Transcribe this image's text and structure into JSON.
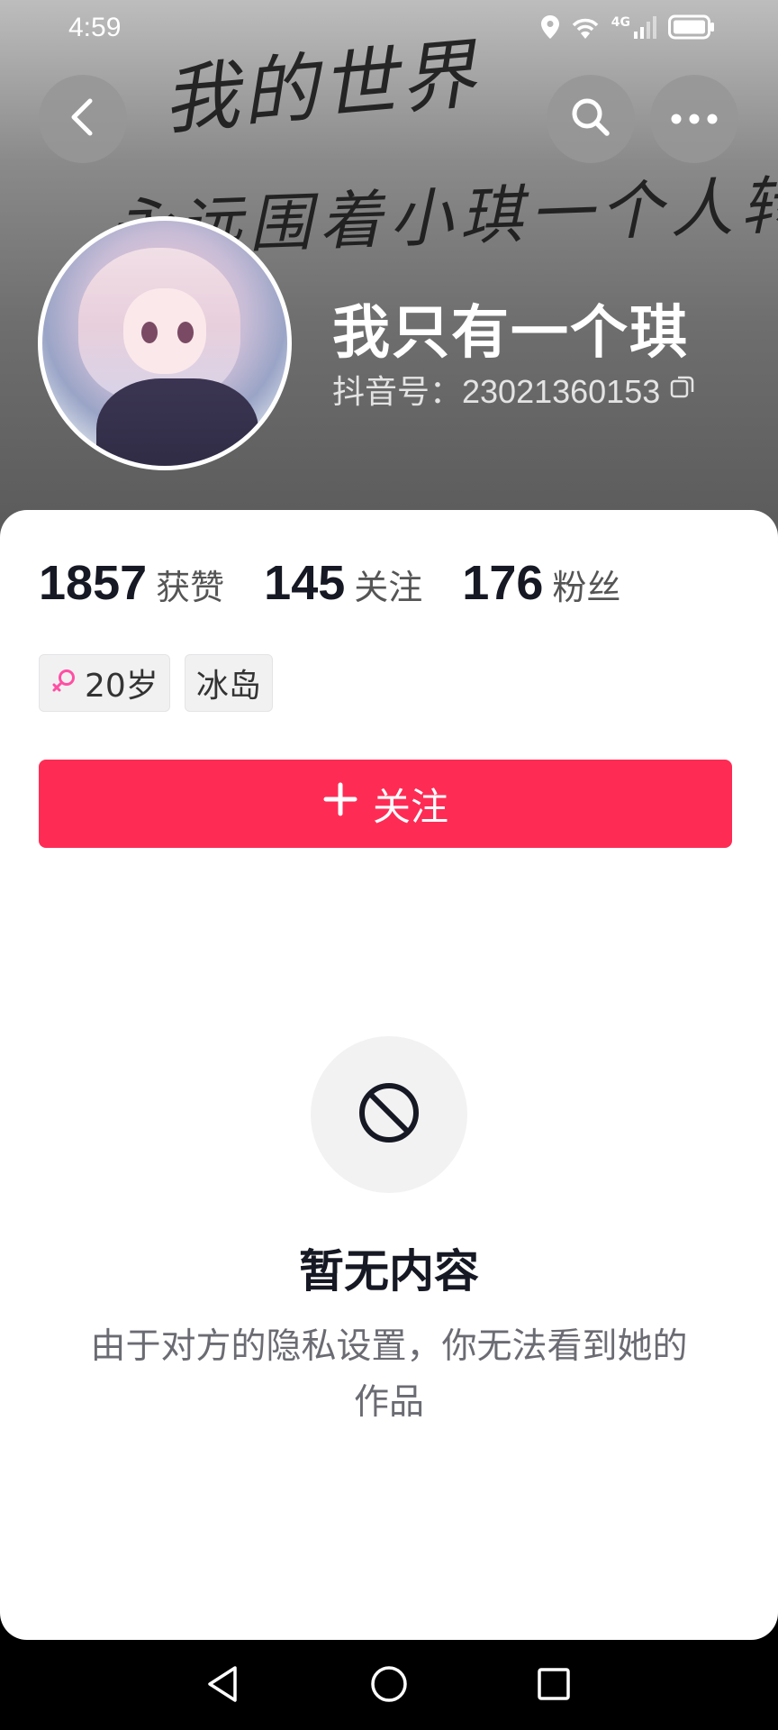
{
  "status_bar": {
    "time": "4:59",
    "network_label": "4G"
  },
  "banner": {
    "line1": "我的世界",
    "line2": "永远围着小琪一个人转"
  },
  "profile": {
    "name": "我只有一个琪",
    "id_text": "抖音号：23021360153"
  },
  "stats": [
    {
      "value": "1857",
      "label": "获赞"
    },
    {
      "value": "145",
      "label": "关注"
    },
    {
      "value": "176",
      "label": "粉丝"
    }
  ],
  "tags": {
    "age": "20岁",
    "location": "冰岛"
  },
  "follow_button": {
    "label": "关注"
  },
  "empty_state": {
    "title": "暂无内容",
    "description": "由于对方的隐私设置，你无法看到她的作品"
  },
  "colors": {
    "accent": "#fe2c55",
    "female_icon": "#ff4fa3"
  }
}
